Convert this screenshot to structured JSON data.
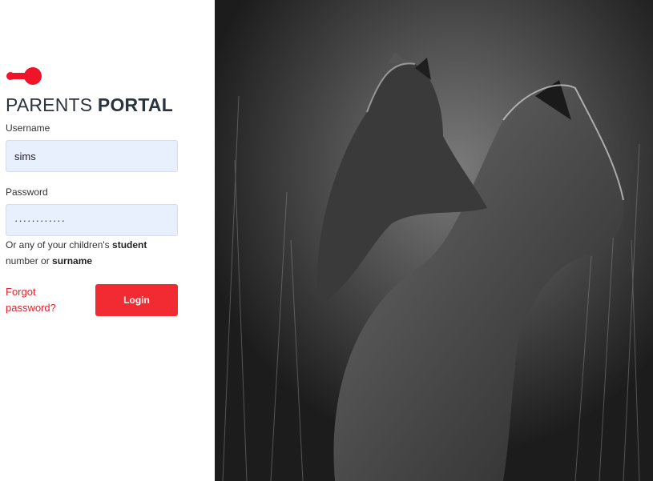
{
  "brand": {
    "title_light": "PARENTS",
    "title_bold": "PORTAL",
    "logo_color": "#f0142b"
  },
  "form": {
    "username_label": "Username",
    "username_value": "sims",
    "password_label": "Password",
    "password_value": "············",
    "hint_prefix": "Or any of your children's",
    "hint_student": "student",
    "hint_middle": "number or",
    "hint_surname": "surname",
    "forgot_label": "Forgot password?",
    "login_label": "Login"
  },
  "colors": {
    "accent": "#f22b33",
    "input_bg": "#e8f0fe"
  },
  "photo": {
    "subject": "lioness-and-cub-bw"
  }
}
